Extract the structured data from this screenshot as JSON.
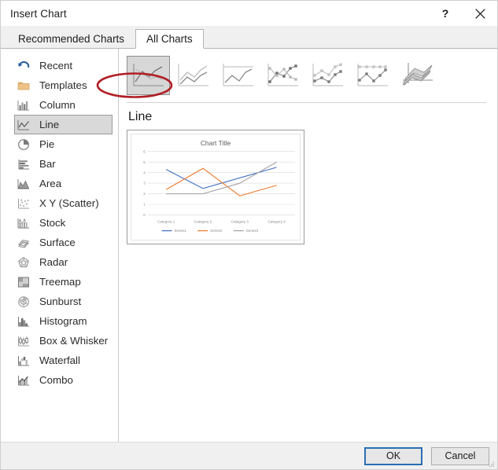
{
  "window": {
    "title": "Insert Chart",
    "help_label": "?",
    "close_label": "✕",
    "help_icon": "question-mark-icon",
    "close_icon": "close-x-icon"
  },
  "tabs": [
    {
      "label": "Recommended Charts",
      "active": false
    },
    {
      "label": "All Charts",
      "active": true
    }
  ],
  "sidebar": {
    "items": [
      {
        "label": "Recent",
        "icon": "recent-undo-arrow-icon",
        "selected": false
      },
      {
        "label": "Templates",
        "icon": "folder-icon",
        "selected": false
      },
      {
        "label": "Column",
        "icon": "column-chart-icon",
        "selected": false
      },
      {
        "label": "Line",
        "icon": "line-chart-icon",
        "selected": true
      },
      {
        "label": "Pie",
        "icon": "pie-chart-icon",
        "selected": false
      },
      {
        "label": "Bar",
        "icon": "bar-chart-icon",
        "selected": false
      },
      {
        "label": "Area",
        "icon": "area-chart-icon",
        "selected": false
      },
      {
        "label": "X Y (Scatter)",
        "icon": "scatter-chart-icon",
        "selected": false
      },
      {
        "label": "Stock",
        "icon": "stock-chart-icon",
        "selected": false
      },
      {
        "label": "Surface",
        "icon": "surface-chart-icon",
        "selected": false
      },
      {
        "label": "Radar",
        "icon": "radar-chart-icon",
        "selected": false
      },
      {
        "label": "Treemap",
        "icon": "treemap-chart-icon",
        "selected": false
      },
      {
        "label": "Sunburst",
        "icon": "sunburst-chart-icon",
        "selected": false
      },
      {
        "label": "Histogram",
        "icon": "histogram-chart-icon",
        "selected": false
      },
      {
        "label": "Box & Whisker",
        "icon": "box-whisker-chart-icon",
        "selected": false
      },
      {
        "label": "Waterfall",
        "icon": "waterfall-chart-icon",
        "selected": false
      },
      {
        "label": "Combo",
        "icon": "combo-chart-icon",
        "selected": false
      }
    ]
  },
  "subtypes": [
    {
      "name": "line",
      "selected": true
    },
    {
      "name": "stacked-line",
      "selected": false
    },
    {
      "name": "100-percent-stacked-line",
      "selected": false
    },
    {
      "name": "line-with-markers",
      "selected": false
    },
    {
      "name": "stacked-line-with-markers",
      "selected": false
    },
    {
      "name": "100-percent-stacked-line-with-markers",
      "selected": false
    },
    {
      "name": "3-d-line",
      "selected": false
    }
  ],
  "preview": {
    "heading": "Line"
  },
  "chart_data": {
    "type": "line",
    "title": "Chart Title",
    "xlabel": "",
    "ylabel": "",
    "categories": [
      "Category 1",
      "Category 2",
      "Category 3",
      "Category 4"
    ],
    "series": [
      {
        "name": "Series1",
        "values": [
          4.3,
          2.5,
          3.5,
          4.5
        ],
        "color": "#4472c4"
      },
      {
        "name": "Series2",
        "values": [
          2.4,
          4.4,
          1.8,
          2.8
        ],
        "color": "#ed7d31"
      },
      {
        "name": "Series3",
        "values": [
          2.0,
          2.0,
          3.0,
          5.0
        ],
        "color": "#a5a5a5"
      }
    ],
    "ylim": [
      0,
      6
    ],
    "yticks": [
      0,
      1,
      2,
      3,
      4,
      5,
      6
    ],
    "grid": true,
    "legend": "bottom"
  },
  "footer": {
    "ok_label": "OK",
    "cancel_label": "Cancel"
  },
  "annotation": {
    "shape": "ellipse",
    "color": "#b01f24",
    "target": "All Charts"
  }
}
